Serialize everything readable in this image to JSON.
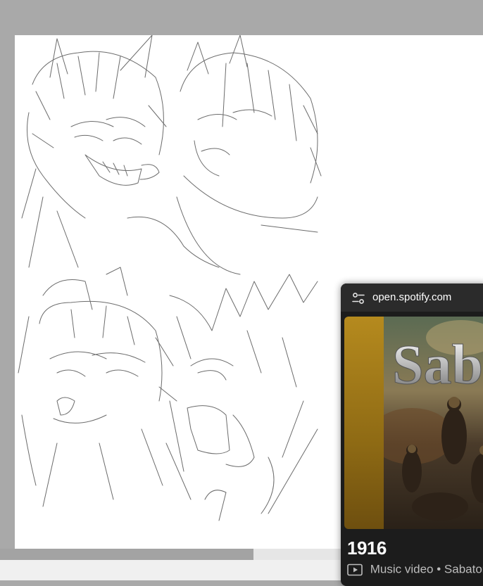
{
  "popup": {
    "site": "open.spotify.com",
    "title": "1916",
    "media_type": "Music video",
    "separator": "•",
    "artist": "Sabaton",
    "album_art_text": "Sab"
  },
  "icons": {
    "site_settings": "tune-icon",
    "media_type": "video-icon"
  },
  "colors": {
    "canvas_background": "#a9a9a9",
    "paper": "#ffffff",
    "popup_background": "#1c1c1c",
    "popup_header": "#2b2b2b",
    "album_gold": "#b58a1e"
  }
}
